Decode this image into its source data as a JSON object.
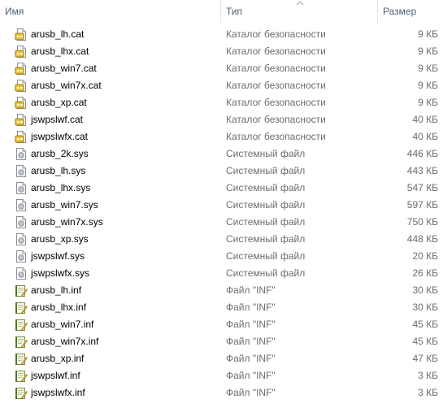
{
  "columns": {
    "name": "Имя",
    "type": "Тип",
    "size": "Размер"
  },
  "files": [
    {
      "name": "arusb_lh.cat",
      "type": "Каталог безопасности",
      "size": "9 КБ",
      "icon": "cat-file-icon"
    },
    {
      "name": "arusb_lhx.cat",
      "type": "Каталог безопасности",
      "size": "9 КБ",
      "icon": "cat-file-icon"
    },
    {
      "name": "arusb_win7.cat",
      "type": "Каталог безопасности",
      "size": "9 КБ",
      "icon": "cat-file-icon"
    },
    {
      "name": "arusb_win7x.cat",
      "type": "Каталог безопасности",
      "size": "9 КБ",
      "icon": "cat-file-icon"
    },
    {
      "name": "arusb_xp.cat",
      "type": "Каталог безопасности",
      "size": "9 КБ",
      "icon": "cat-file-icon"
    },
    {
      "name": "jswpslwf.cat",
      "type": "Каталог безопасности",
      "size": "40 КБ",
      "icon": "cat-file-icon"
    },
    {
      "name": "jswpslwfx.cat",
      "type": "Каталог безопасности",
      "size": "40 КБ",
      "icon": "cat-file-icon"
    },
    {
      "name": "arusb_2k.sys",
      "type": "Системный файл",
      "size": "446 КБ",
      "icon": "sys-file-icon"
    },
    {
      "name": "arusb_lh.sys",
      "type": "Системный файл",
      "size": "443 КБ",
      "icon": "sys-file-icon"
    },
    {
      "name": "arusb_lhx.sys",
      "type": "Системный файл",
      "size": "547 КБ",
      "icon": "sys-file-icon"
    },
    {
      "name": "arusb_win7.sys",
      "type": "Системный файл",
      "size": "597 КБ",
      "icon": "sys-file-icon"
    },
    {
      "name": "arusb_win7x.sys",
      "type": "Системный файл",
      "size": "750 КБ",
      "icon": "sys-file-icon"
    },
    {
      "name": "arusb_xp.sys",
      "type": "Системный файл",
      "size": "448 КБ",
      "icon": "sys-file-icon"
    },
    {
      "name": "jswpslwf.sys",
      "type": "Системный файл",
      "size": "20 КБ",
      "icon": "sys-file-icon"
    },
    {
      "name": "jswpslwfx.sys",
      "type": "Системный файл",
      "size": "26 КБ",
      "icon": "sys-file-icon"
    },
    {
      "name": "arusb_lh.inf",
      "type": "Файл \"INF\"",
      "size": "30 КБ",
      "icon": "inf-file-icon"
    },
    {
      "name": "arusb_lhx.inf",
      "type": "Файл \"INF\"",
      "size": "30 КБ",
      "icon": "inf-file-icon"
    },
    {
      "name": "arusb_win7.inf",
      "type": "Файл \"INF\"",
      "size": "45 КБ",
      "icon": "inf-file-icon"
    },
    {
      "name": "arusb_win7x.inf",
      "type": "Файл \"INF\"",
      "size": "45 КБ",
      "icon": "inf-file-icon"
    },
    {
      "name": "arusb_xp.inf",
      "type": "Файл \"INF\"",
      "size": "47 КБ",
      "icon": "inf-file-icon"
    },
    {
      "name": "jswpslwf.inf",
      "type": "Файл \"INF\"",
      "size": "3 КБ",
      "icon": "inf-file-icon"
    },
    {
      "name": "jswpslwfx.inf",
      "type": "Файл \"INF\"",
      "size": "3 КБ",
      "icon": "inf-file-icon"
    }
  ]
}
